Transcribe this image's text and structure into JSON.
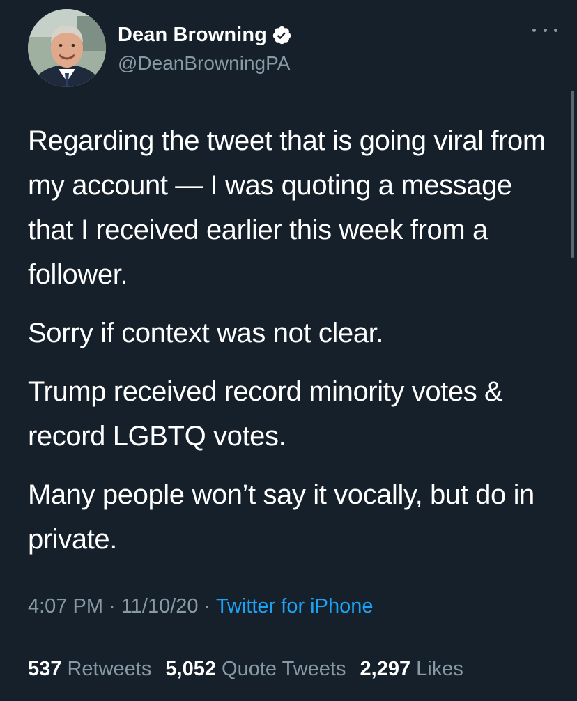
{
  "tweet": {
    "author": {
      "display_name": "Dean Browning",
      "handle": "@DeanBrowningPA",
      "verified": true
    },
    "paragraphs": [
      "Regarding the tweet that is going viral from my account — I was quoting a message that I received earlier this week from a follower.",
      "Sorry if context was not clear.",
      "Trump received record minority votes & record LGBTQ votes.",
      "Many people won’t say it vocally, but do in private."
    ],
    "time": "4:07 PM",
    "separator": "·",
    "date": "11/10/20",
    "source": "Twitter for iPhone",
    "stats": {
      "retweets_count": "537",
      "retweets_label": "Retweets",
      "quote_tweets_count": "5,052",
      "quote_tweets_label": "Quote Tweets",
      "likes_count": "2,297",
      "likes_label": "Likes"
    }
  },
  "icons": {
    "verified": "verified-badge-icon",
    "more": "more-options-icon"
  },
  "colors": {
    "background": "#15202b",
    "text": "#ffffff",
    "secondary": "#8899a6",
    "link": "#1da1f2",
    "divider": "#38444d"
  }
}
